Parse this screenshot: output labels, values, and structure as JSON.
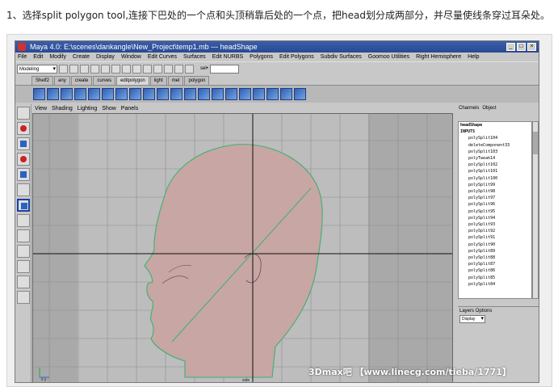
{
  "caption": "1、选择split polygon tool,连接下巴处的一个点和头顶稍靠后处的一个点，把head划分成两部分，并尽量使线条穿过耳朵处。",
  "window": {
    "title": "Maya 4.0: E:\\scenes\\dankangle\\New_Project\\temp1.mb   ---   headShape",
    "buttons": [
      "_",
      "□",
      "×"
    ]
  },
  "menubar": [
    "File",
    "Edit",
    "Modify",
    "Create",
    "Display",
    "Window",
    "Edit Curves",
    "Surfaces",
    "Edit NURBS",
    "Polygons",
    "Edit Polygons",
    "Subdiv Surfaces",
    "Goomoo Utilities",
    "Right Hemisphere",
    "Help"
  ],
  "statusline": {
    "mode": "Modeling",
    "sel_label": "sel•"
  },
  "shelf_tabs": [
    {
      "label": "Shelf2",
      "active": false
    },
    {
      "label": "any",
      "active": false
    },
    {
      "label": "create",
      "active": false
    },
    {
      "label": "curves",
      "active": false
    },
    {
      "label": "editpolygon",
      "active": true
    },
    {
      "label": "light",
      "active": false
    },
    {
      "label": "mel",
      "active": false
    },
    {
      "label": "polygon",
      "active": false
    }
  ],
  "panel_menu": [
    "View",
    "Shading",
    "Lighting",
    "Show",
    "Panels"
  ],
  "viewport": {
    "camera_label": "side",
    "axis_label": "z y"
  },
  "channel_box": {
    "tabs": [
      "Channels",
      "Object"
    ],
    "node": "headShape",
    "inputs_label": "INPUTS",
    "items": [
      "polySplit104",
      "deleteComponent33",
      "polySplit103",
      "polyTweak14",
      "polySplit102",
      "polySplit101",
      "polySplit100",
      "polySplit99",
      "polySplit98",
      "polySplit97",
      "polySplit96",
      "polySplit95",
      "polySplit94",
      "polySplit93",
      "polySplit92",
      "polySplit91",
      "polySplit90",
      "polySplit89",
      "polySplit88",
      "polySplit87",
      "polySplit86",
      "polySplit85",
      "polySplit84"
    ]
  },
  "layers": {
    "tabs": [
      "Layers",
      "Options"
    ],
    "display": "Display"
  },
  "watermark": "3Dmax吧 【www.linecg.com/tieba/1771】",
  "colors": {
    "title_bar": "#2f52a0",
    "head_fill": "#c7a6a4",
    "head_outline": "#3cb072",
    "grid_line": "#8e8e8e",
    "axis_line": "#111111"
  }
}
